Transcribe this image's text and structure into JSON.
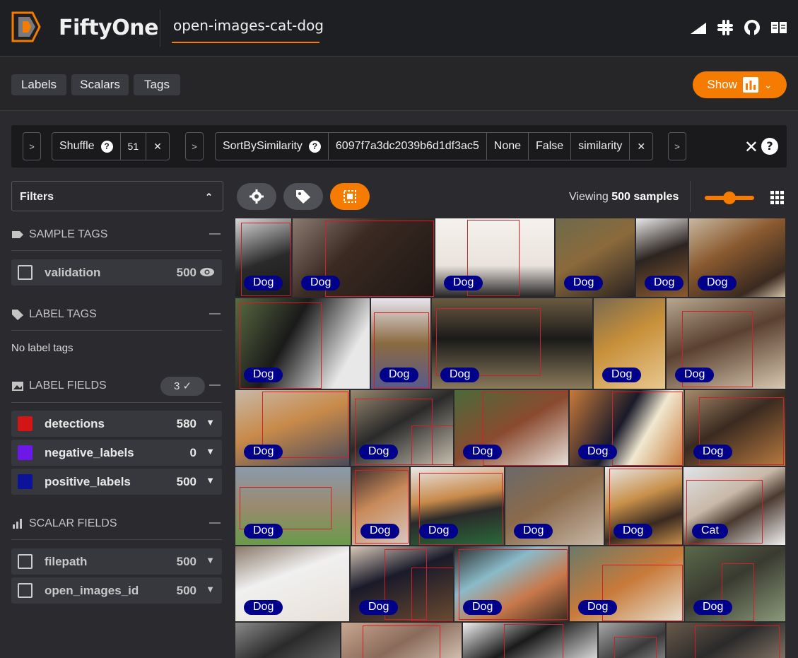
{
  "header": {
    "brand": "FiftyOne",
    "dataset_name": "open-images-cat-dog",
    "icons": [
      "signal-icon",
      "slack-icon",
      "github-icon",
      "docs-icon"
    ]
  },
  "toolbar": {
    "tabs": [
      "Labels",
      "Scalars",
      "Tags"
    ],
    "show_label": "Show",
    "accent": "#f57c00"
  },
  "view_bar": {
    "stages": [
      {
        "name": "Shuffle",
        "params": [
          "51"
        ]
      },
      {
        "name": "SortBySimilarity",
        "params": [
          "6097f7a3dc2039b6d1df3ac5",
          "None",
          "False",
          "similarity"
        ]
      }
    ],
    "help": "?"
  },
  "sidebar": {
    "filters_label": "Filters",
    "sample_tags": {
      "title": "SAMPLE TAGS",
      "items": [
        {
          "name": "validation",
          "count": "500"
        }
      ]
    },
    "label_tags": {
      "title": "LABEL TAGS",
      "empty_text": "No label tags"
    },
    "label_fields": {
      "title": "LABEL FIELDS",
      "badge": "3 ✓",
      "items": [
        {
          "name": "detections",
          "count": "580",
          "color": "#d21515"
        },
        {
          "name": "negative_labels",
          "count": "0",
          "color": "#6b18e8"
        },
        {
          "name": "positive_labels",
          "count": "500",
          "color": "#0b139a"
        }
      ]
    },
    "scalar_fields": {
      "title": "SCALAR FIELDS",
      "items": [
        {
          "name": "filepath",
          "count": "500"
        },
        {
          "name": "open_images_id",
          "count": "500"
        }
      ]
    }
  },
  "grid_header": {
    "viewing_prefix": "Viewing",
    "viewing_count": "500 samples"
  },
  "samples": [
    {
      "label": "Dog",
      "image": "black german shepherd on white background"
    },
    {
      "label": "Dog",
      "image": "black and tan dog lying down, mouth open"
    },
    {
      "label": "Dog",
      "image": "black dog standing on white backdrop"
    },
    {
      "label": "Dog",
      "image": "german shepherd panting, tongue out"
    },
    {
      "label": "Dog",
      "image": "black and tan puppy portrait"
    },
    {
      "label": "Dog",
      "image": "german shepherd on sandy beach"
    },
    {
      "label": "Dog",
      "image": "black dog with white chest, close-up"
    },
    {
      "label": "Dog",
      "image": "german shepherd puppy in harness"
    },
    {
      "label": "Dog",
      "image": "black dog walking on dry grass"
    },
    {
      "label": "Dog",
      "image": "tan dog face close-up"
    },
    {
      "label": "Dog",
      "image": "small dog being petted by hand"
    },
    {
      "label": "Dog",
      "image": "tan dog lying on dog bed"
    },
    {
      "label": "Dog",
      "image": "two dogs on wooden floor"
    },
    {
      "label": "Dog",
      "image": "brown and white dog looking up"
    },
    {
      "label": "Dog",
      "image": "husky with blue eyes"
    },
    {
      "label": "Dog",
      "image": "german shepherd resting"
    },
    {
      "label": "Dog",
      "image": "dingo walking on grass"
    },
    {
      "label": "Dog",
      "image": "corgi held close, indoors"
    },
    {
      "label": "Dog",
      "image": "corgi standing on lawn"
    },
    {
      "label": "Dog",
      "image": "bulldog puppies close-up"
    },
    {
      "label": "Dog",
      "image": "french bulldog portrait"
    },
    {
      "label": "Cat",
      "image": "siamese cat sitting"
    },
    {
      "label": "Dog",
      "image": "white fluffy dog lying down"
    },
    {
      "label": "Dog",
      "image": "police officers with dog"
    },
    {
      "label": "Dog",
      "image": "shiba inu in blue sweater"
    },
    {
      "label": "Dog",
      "image": "fox curled up on ground"
    },
    {
      "label": "Dog",
      "image": "small dog in yard"
    }
  ]
}
